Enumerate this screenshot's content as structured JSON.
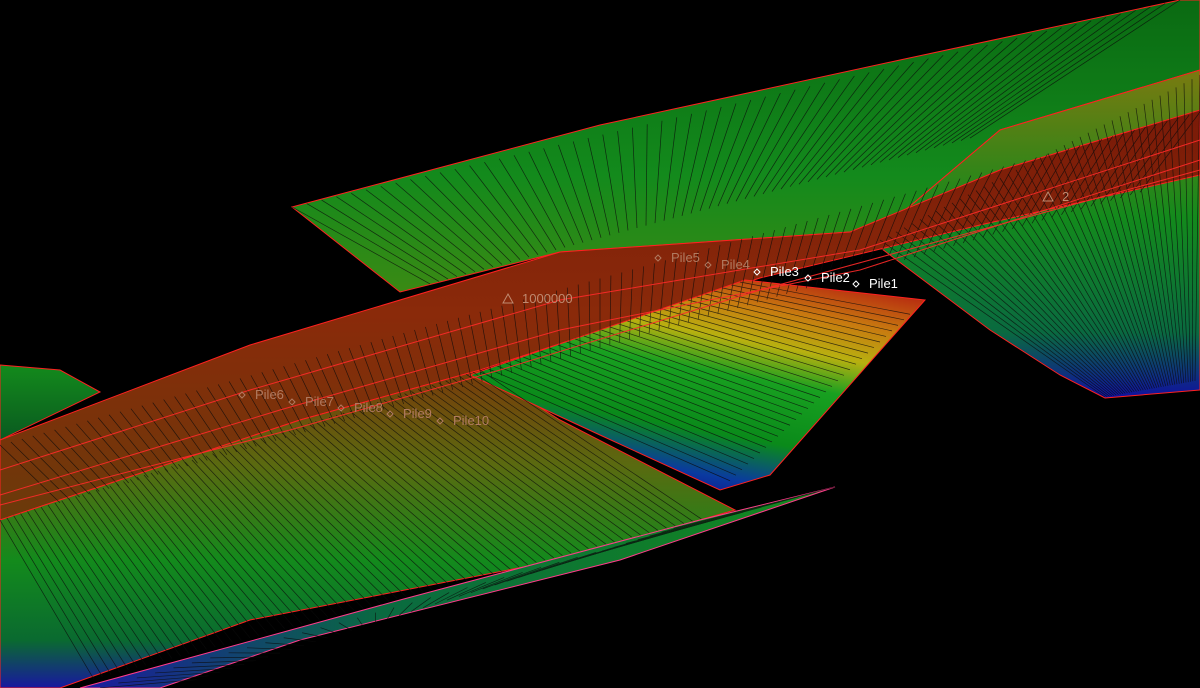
{
  "viewport": {
    "background": "#000000",
    "edge_color": "#ff2020",
    "mesh_color": "#0b0b0b",
    "elevation_ramp": [
      "#00006a",
      "#0033a0",
      "#007a1a",
      "#16a020",
      "#a0b010",
      "#b86a10",
      "#8a1a0a"
    ]
  },
  "markers": [
    {
      "label": "Pile1",
      "icon": "diamond-icon",
      "emphasis": "bright"
    },
    {
      "label": "Pile2",
      "icon": "diamond-icon",
      "emphasis": "bright"
    },
    {
      "label": "Pile3",
      "icon": "diamond-icon",
      "emphasis": "bright"
    },
    {
      "label": "Pile4",
      "icon": "diamond-icon",
      "emphasis": "dim"
    },
    {
      "label": "Pile5",
      "icon": "diamond-icon",
      "emphasis": "dim"
    },
    {
      "label": "Pile6",
      "icon": "diamond-icon",
      "emphasis": "dim"
    },
    {
      "label": "Pile7",
      "icon": "diamond-icon",
      "emphasis": "dim"
    },
    {
      "label": "Pile8",
      "icon": "diamond-icon",
      "emphasis": "dim"
    },
    {
      "label": "Pile9",
      "icon": "diamond-icon",
      "emphasis": "dim"
    },
    {
      "label": "Pile10",
      "icon": "diamond-icon",
      "emphasis": "dim"
    }
  ],
  "stations": [
    {
      "label": "1000000",
      "icon": "triangle-icon"
    },
    {
      "label": "2",
      "icon": "triangle-icon"
    }
  ]
}
